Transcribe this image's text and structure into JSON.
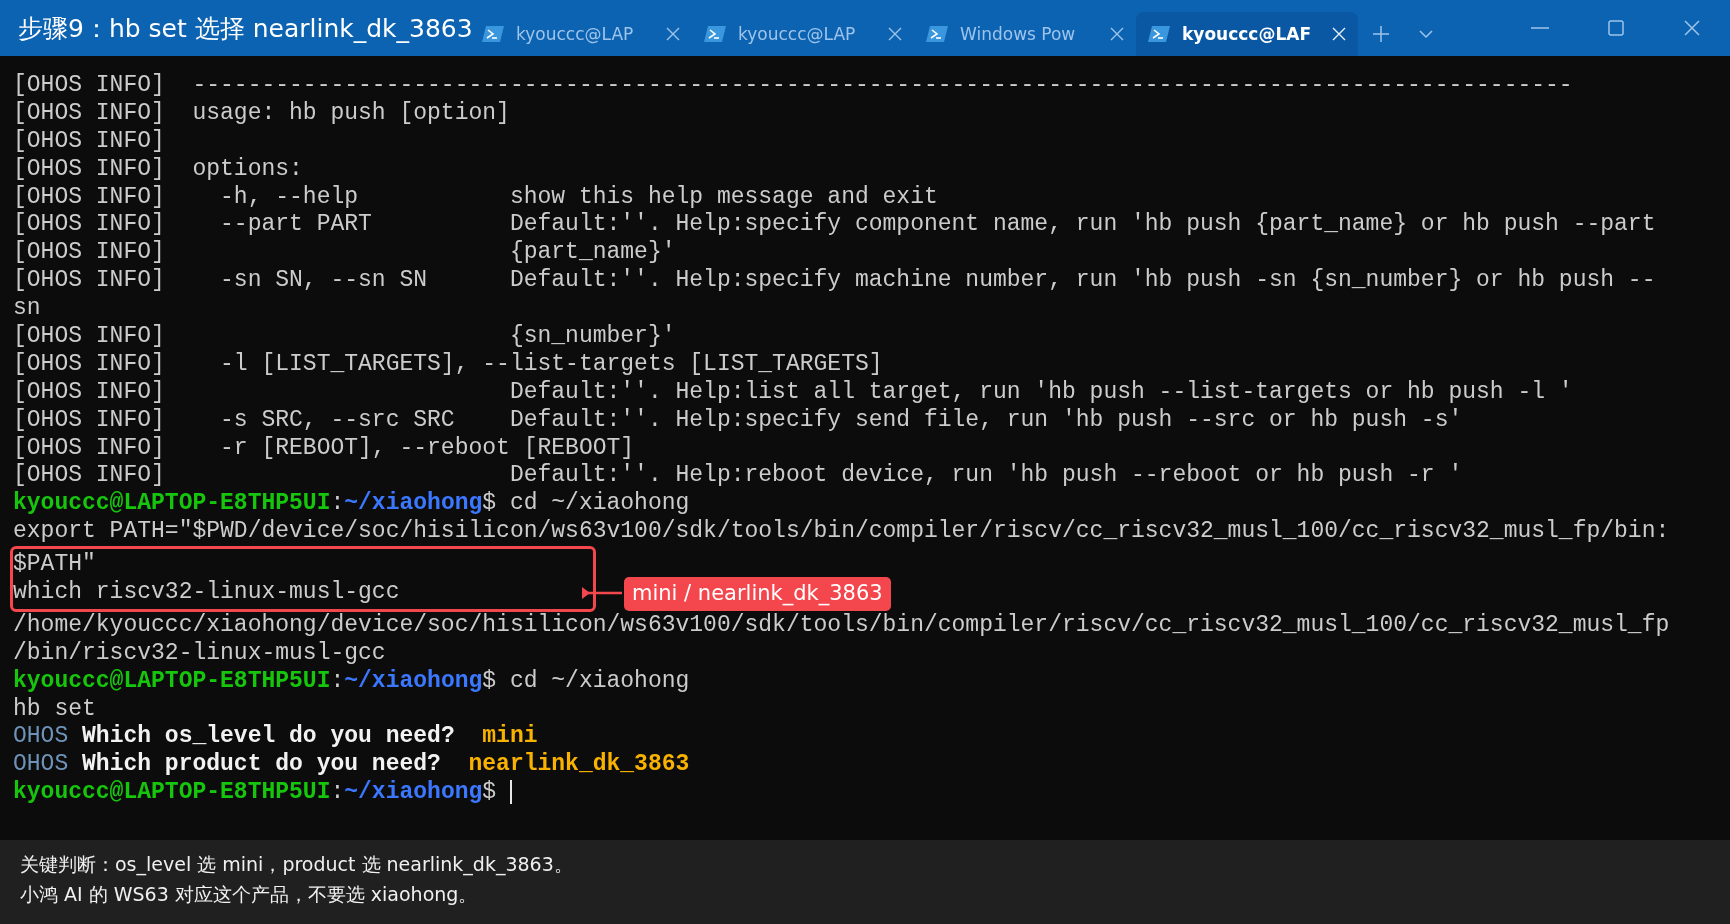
{
  "title": "步骤9：hb set 选择 nearlink_dk_3863",
  "tabs": [
    {
      "label": "kyouccc@LAP",
      "selected": false
    },
    {
      "label": "kyouccc@LAP",
      "selected": false
    },
    {
      "label": "Windows Pow",
      "selected": false
    },
    {
      "label": "kyouccc@LAF",
      "selected": true
    }
  ],
  "terminal": {
    "lines": [
      {
        "framed": false,
        "segments": [
          {
            "kind": "plain",
            "text": "[OHOS INFO]  ----------------------------------------------------------------------------------------------------"
          }
        ]
      },
      {
        "framed": false,
        "segments": [
          {
            "kind": "plain",
            "text": "[OHOS INFO]  usage: hb push [option]"
          }
        ]
      },
      {
        "framed": false,
        "segments": [
          {
            "kind": "plain",
            "text": "[OHOS INFO]"
          }
        ]
      },
      {
        "framed": false,
        "segments": [
          {
            "kind": "plain",
            "text": "[OHOS INFO]  options:"
          }
        ]
      },
      {
        "framed": false,
        "segments": [
          {
            "kind": "plain",
            "text": "[OHOS INFO]    -h, --help           show this help message and exit"
          }
        ]
      },
      {
        "framed": false,
        "segments": [
          {
            "kind": "plain",
            "text": "[OHOS INFO]    --part PART          Default:''. Help:specify component name, run 'hb push {part_name} or hb push --part"
          }
        ]
      },
      {
        "framed": false,
        "segments": [
          {
            "kind": "plain",
            "text": "[OHOS INFO]                         {part_name}'"
          }
        ]
      },
      {
        "framed": false,
        "segments": [
          {
            "kind": "plain",
            "text": "[OHOS INFO]    -sn SN, --sn SN      Default:''. Help:specify machine number, run 'hb push -sn {sn_number} or hb push --"
          }
        ]
      },
      {
        "framed": false,
        "segments": [
          {
            "kind": "plain",
            "text": "sn"
          }
        ]
      },
      {
        "framed": false,
        "segments": [
          {
            "kind": "plain",
            "text": "[OHOS INFO]                         {sn_number}'"
          }
        ]
      },
      {
        "framed": false,
        "segments": [
          {
            "kind": "plain",
            "text": "[OHOS INFO]    -l [LIST_TARGETS], --list-targets [LIST_TARGETS]"
          }
        ]
      },
      {
        "framed": false,
        "segments": [
          {
            "kind": "plain",
            "text": "[OHOS INFO]                         Default:''. Help:list all target, run 'hb push --list-targets or hb push -l '"
          }
        ]
      },
      {
        "framed": false,
        "segments": [
          {
            "kind": "plain",
            "text": "[OHOS INFO]    -s SRC, --src SRC    Default:''. Help:specify send file, run 'hb push --src or hb push -s'"
          }
        ]
      },
      {
        "framed": false,
        "segments": [
          {
            "kind": "plain",
            "text": "[OHOS INFO]    -r [REBOOT], --reboot [REBOOT]"
          }
        ]
      },
      {
        "framed": false,
        "segments": [
          {
            "kind": "plain",
            "text": "[OHOS INFO]                         Default:''. Help:reboot device, run 'hb push --reboot or hb push -r '"
          }
        ]
      },
      {
        "framed": false,
        "segments": [
          {
            "kind": "user",
            "text": "kyouccc@LAPTOP-E8THP5UI"
          },
          {
            "kind": "plain",
            "text": ":"
          },
          {
            "kind": "path",
            "text": "~/xiaohong"
          },
          {
            "kind": "plain",
            "text": "$ cd ~/xiaohong"
          }
        ]
      },
      {
        "framed": false,
        "segments": [
          {
            "kind": "plain",
            "text": "export PATH=\"$PWD/device/soc/hisilicon/ws63v100/sdk/tools/bin/compiler/riscv/cc_riscv32_musl_100/cc_riscv32_musl_fp/bin:"
          }
        ]
      },
      {
        "framed": true,
        "segments": [
          {
            "kind": "plain",
            "text": "$PATH\""
          }
        ]
      },
      {
        "framed": true,
        "segments": [
          {
            "kind": "plain",
            "text": "which riscv32-linux-musl-gcc"
          }
        ]
      },
      {
        "framed": false,
        "segments": [
          {
            "kind": "plain",
            "text": "/home/kyouccc/xiaohong/device/soc/hisilicon/ws63v100/sdk/tools/bin/compiler/riscv/cc_riscv32_musl_100/cc_riscv32_musl_fp"
          }
        ]
      },
      {
        "framed": false,
        "segments": [
          {
            "kind": "plain",
            "text": "/bin/riscv32-linux-musl-gcc"
          }
        ]
      },
      {
        "framed": false,
        "segments": [
          {
            "kind": "user",
            "text": "kyouccc@LAPTOP-E8THP5UI"
          },
          {
            "kind": "plain",
            "text": ":"
          },
          {
            "kind": "path",
            "text": "~/xiaohong"
          },
          {
            "kind": "plain",
            "text": "$ cd ~/xiaohong"
          }
        ]
      },
      {
        "framed": false,
        "segments": [
          {
            "kind": "plain",
            "text": "hb set"
          }
        ]
      },
      {
        "framed": false,
        "segments": [
          {
            "kind": "ohos",
            "text": "OHOS"
          },
          {
            "kind": "bold",
            "text": " Which os_level do you need?  "
          },
          {
            "kind": "answer",
            "text": "mini"
          }
        ]
      },
      {
        "framed": false,
        "segments": [
          {
            "kind": "ohos",
            "text": "OHOS"
          },
          {
            "kind": "bold",
            "text": " Which product do you need?  "
          },
          {
            "kind": "answer",
            "text": "nearlink_dk_3863"
          }
        ]
      },
      {
        "framed": false,
        "segments": [
          {
            "kind": "user",
            "text": "kyouccc@LAPTOP-E8THP5UI"
          },
          {
            "kind": "plain",
            "text": ":"
          },
          {
            "kind": "path",
            "text": "~/xiaohong"
          },
          {
            "kind": "plain",
            "text": "$ "
          }
        ]
      }
    ],
    "cursor": true
  },
  "callout": {
    "label": "mini / nearlink_dk_3863"
  },
  "caption": [
    "关键判断：os_level 选 mini，product 选 nearlink_dk_3863。",
    "小鸿 AI 的 WS63 对应这个产品，不要选 xiaohong。"
  ]
}
